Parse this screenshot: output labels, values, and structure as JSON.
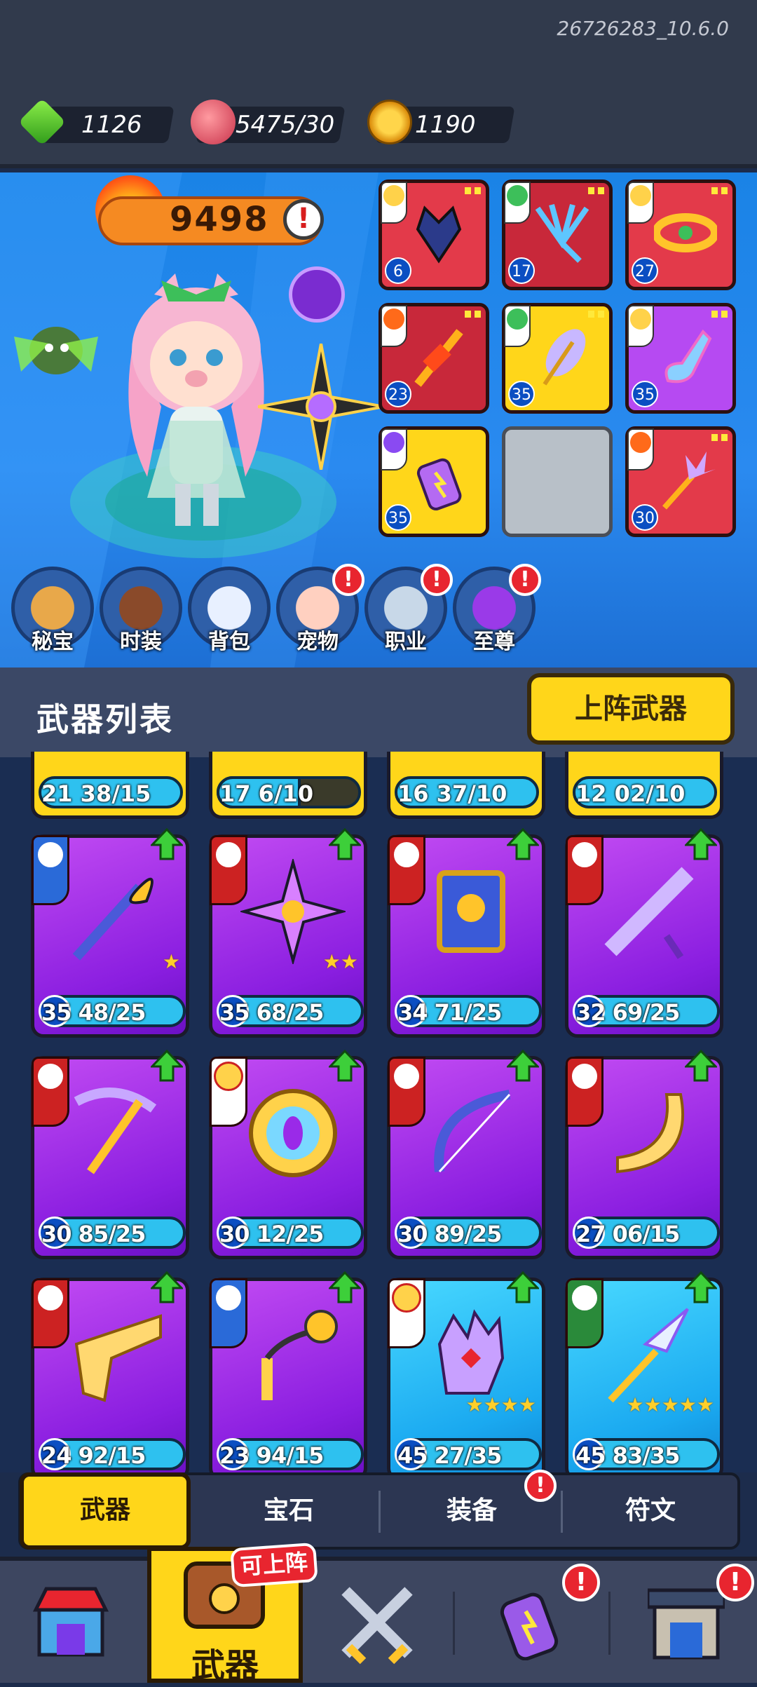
{
  "version": "26726283_10.6.0",
  "resources": {
    "gems": "1126",
    "meat": "5475/30",
    "coins": "1190"
  },
  "power": "9498",
  "info_icon": "!",
  "equipment": [
    {
      "level": "6",
      "color": "red",
      "icon": "dragon-helmet-icon"
    },
    {
      "level": "17",
      "color": "red",
      "icon": "trident-claw-icon"
    },
    {
      "level": "27",
      "color": "red",
      "icon": "belt-icon"
    },
    {
      "level": "23",
      "color": "red",
      "icon": "flame-sword-icon"
    },
    {
      "level": "35",
      "color": "yellow",
      "icon": "feather-icon"
    },
    {
      "level": "35",
      "color": "purple",
      "icon": "magic-boot-icon"
    },
    {
      "level": "35",
      "color": "yellow",
      "icon": "lightning-bottle-icon"
    },
    {
      "level": "",
      "color": "empty",
      "icon": "empty-slot"
    },
    {
      "level": "30",
      "color": "red",
      "icon": "crystal-scepter-icon"
    }
  ],
  "round_buttons": [
    {
      "label": "秘宝",
      "icon": "treasure-pot-icon",
      "alert": false
    },
    {
      "label": "时装",
      "icon": "hat-icon",
      "alert": false
    },
    {
      "label": "背包",
      "icon": "robot-backpack-icon",
      "alert": false
    },
    {
      "label": "宠物",
      "icon": "paw-icon",
      "alert": true
    },
    {
      "label": "职业",
      "icon": "sword-shield-icon",
      "alert": true
    },
    {
      "label": "至尊",
      "icon": "purple-gem-icon",
      "alert": true
    }
  ],
  "weapon_section": {
    "title": "武器列表",
    "deploy_button": "上阵武器"
  },
  "partial_row": [
    "21 38/15",
    "17 6/10",
    "16 37/10",
    "12 02/10"
  ],
  "weapon_cards": [
    {
      "text": "35 48/25",
      "rarity": "purple",
      "stars": "★",
      "icon": "ice-staff-icon"
    },
    {
      "text": "35 68/25",
      "rarity": "purple",
      "stars": "★★",
      "icon": "shuriken-icon"
    },
    {
      "text": "34 71/25",
      "rarity": "purple",
      "stars": "",
      "icon": "spellbook-icon"
    },
    {
      "text": "32 69/25",
      "rarity": "purple",
      "stars": "",
      "icon": "spiked-club-icon"
    },
    {
      "text": "30 85/25",
      "rarity": "purple",
      "stars": "",
      "icon": "crossbow-icon"
    },
    {
      "text": "30 12/25",
      "rarity": "purple",
      "stars": "",
      "icon": "sun-shield-icon"
    },
    {
      "text": "30 89/25",
      "rarity": "purple",
      "stars": "",
      "icon": "bow-icon"
    },
    {
      "text": "27 06/15",
      "rarity": "purple",
      "stars": "",
      "icon": "boomerang-icon"
    },
    {
      "text": "24 92/15",
      "rarity": "purple",
      "stars": "",
      "icon": "pistol-icon"
    },
    {
      "text": "23 94/15",
      "rarity": "purple",
      "stars": "",
      "icon": "flail-icon"
    },
    {
      "text": "45 27/35",
      "rarity": "blue",
      "stars": "★★★★",
      "icon": "glove-icon"
    },
    {
      "text": "45 83/35",
      "rarity": "blue",
      "stars": "★★★★★",
      "icon": "crystal-spear-icon"
    }
  ],
  "tabs": [
    {
      "label": "武器",
      "active": true
    },
    {
      "label": "宝石",
      "active": false
    },
    {
      "label": "装备",
      "active": false,
      "alert": true
    },
    {
      "label": "符文",
      "active": false
    }
  ],
  "bottom_nav": {
    "active_label": "武器",
    "badge": "可上阵",
    "alert": "!"
  },
  "colors": {
    "accent_yellow": "#ffd61a",
    "hero_blue": "#1a83e6",
    "alert_red": "#e8252f"
  }
}
